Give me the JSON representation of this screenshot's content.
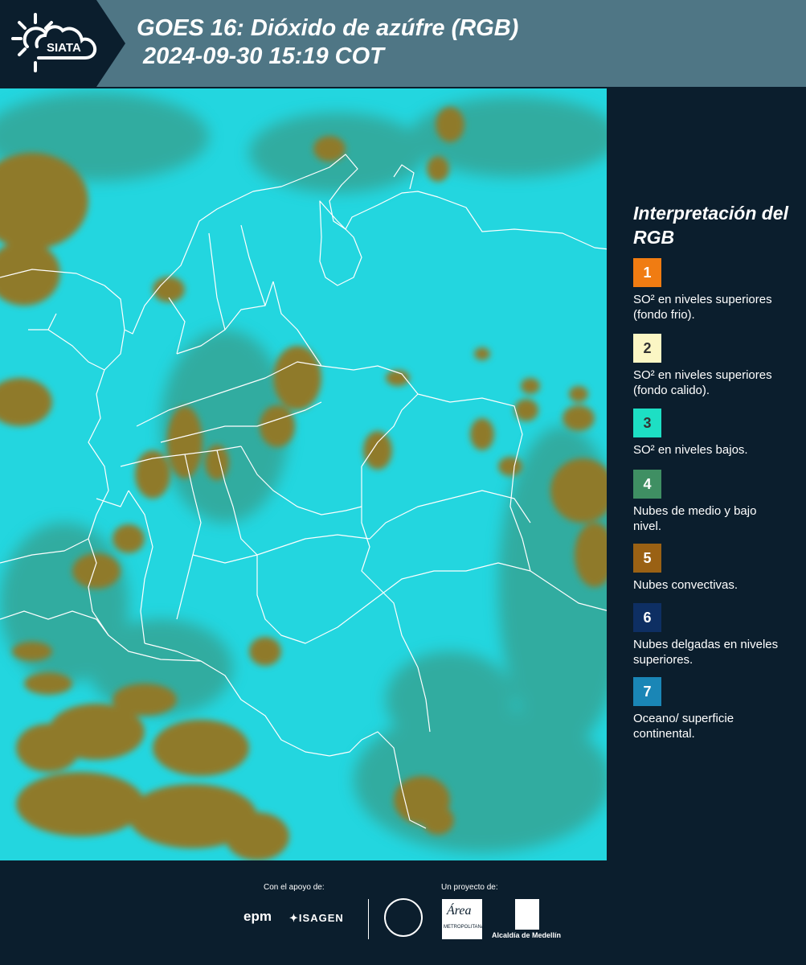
{
  "header": {
    "logo_text": "SIATA",
    "title_line1": "GOES 16: Dióxido de azúfre (RGB)",
    "title_line2": " 2024-09-30 15:19 COT",
    "colors": {
      "band": "#4f7685",
      "dark": "#0b1e2d"
    }
  },
  "map": {
    "colors": {
      "surface": "#23d6df",
      "clouds_convective": "#8f7a2a",
      "clouds_mid_low": "#3d8a6e",
      "borders": "#ffffff"
    }
  },
  "legend": {
    "title": "Interpretación del RGB",
    "items": [
      {
        "number": "1",
        "color": "#f07c12",
        "text": "SO² en niveles superiores (fondo frio)."
      },
      {
        "number": "2",
        "color": "#fbf6c4",
        "text": "SO² en niveles superiores (fondo calido)."
      },
      {
        "number": "3",
        "color": "#1ddfc4",
        "text": "SO² en niveles bajos."
      },
      {
        "number": "4",
        "color": "#3f8f63",
        "text": "Nubes de medio y bajo nivel."
      },
      {
        "number": "5",
        "color": "#9a6114",
        "text": "Nubes convectivas."
      },
      {
        "number": "6",
        "color": "#0e2f63",
        "text": "Nubes delgadas en niveles superiores."
      },
      {
        "number": "7",
        "color": "#1a86b6",
        "text": "Oceano/ superficie continental."
      }
    ]
  },
  "footer": {
    "support_label": "Con el apoyo de:",
    "project_label": "Un proyecto de:",
    "sponsor_epm": "epm",
    "sponsor_isagen": "ISAGEN",
    "amva_text": "Área",
    "amva_subtext": "METROPOLITANA",
    "alcaldia_text": "Alcaldía de Medellín"
  }
}
